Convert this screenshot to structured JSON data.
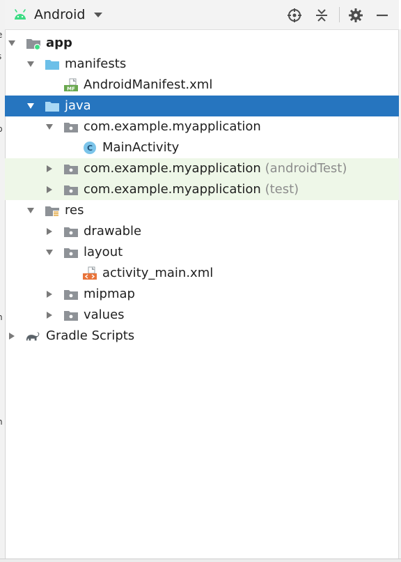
{
  "toolbar": {
    "view_selector_label": "Android",
    "icons": [
      "locate-icon",
      "collapse-all-icon",
      "gear-icon",
      "minimize-icon"
    ]
  },
  "tree": {
    "app": "app",
    "manifests": "manifests",
    "android_manifest": "AndroidManifest.xml",
    "manifest_badge": "MF",
    "java": "java",
    "pkg_main": "com.example.myapplication",
    "main_activity": "MainActivity",
    "class_badge": "C",
    "pkg_android_test": "com.example.myapplication",
    "pkg_android_test_suffix": "(androidTest)",
    "pkg_test": "com.example.myapplication",
    "pkg_test_suffix": "(test)",
    "res": "res",
    "drawable": "drawable",
    "layout": "layout",
    "activity_main": "activity_main.xml",
    "mipmap": "mipmap",
    "values": "values",
    "gradle_scripts": "Gradle Scripts"
  },
  "gutter": {
    "frag_1": "e",
    "frag_2": "s",
    "frag_3": "p",
    "frag_4": "n",
    "frag_5": "n"
  },
  "colors": {
    "selection": "#2675bf",
    "test_source_bg": "#eef7e8",
    "folder_blue": "#6cbfe8",
    "folder_gray": "#8e9297",
    "android_green": "#3ddc84"
  }
}
